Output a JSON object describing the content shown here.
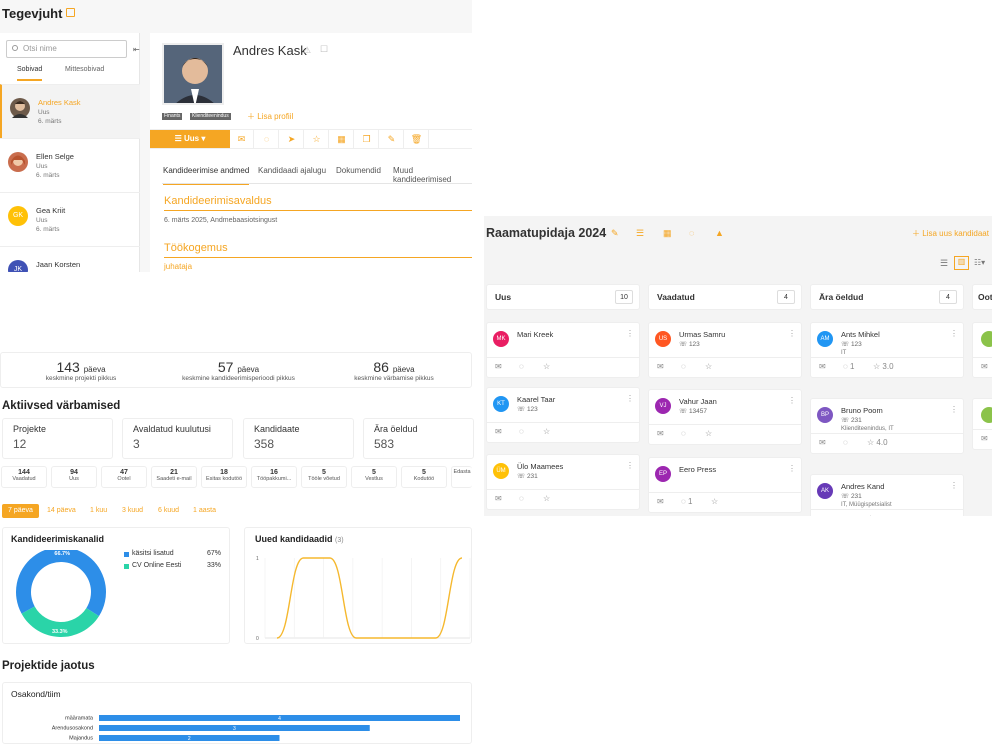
{
  "header": {
    "title": "Tegevjuht"
  },
  "sidebar": {
    "search_placeholder": "Otsi nime",
    "tabs": [
      "Sobivad",
      "Mittesobivad"
    ],
    "candidates": [
      {
        "name": "Andres Kask",
        "status": "Uus",
        "date": "6. märts"
      },
      {
        "name": "Ellen Selge",
        "status": "Uus",
        "date": "6. märts"
      },
      {
        "initials": "GK",
        "name": "Gea Kriit",
        "status": "Uus",
        "date": "6. märts"
      },
      {
        "initials": "JK",
        "name": "Jaan Korsten"
      }
    ]
  },
  "profile": {
    "name": "Andres Kask",
    "tags": [
      "Finants",
      "Klienditeenindus"
    ],
    "add_profile": "Lisa profiil",
    "new_button": "Uus",
    "tabs": [
      "Kandideerimise andmed",
      "Kandidaadi ajalugu",
      "Dokumendid",
      "Muud kandideerimised"
    ],
    "application_title": "Kandideerimisavaldus",
    "application_detail": "6. märts 2025, Andmebaasiotsingust",
    "experience_title": "Töökogemus",
    "experience_first": "juhataja"
  },
  "stats": [
    {
      "value": "143",
      "unit": "päeva",
      "label": "keskmine projekti pikkus"
    },
    {
      "value": "57",
      "unit": "päeva",
      "label": "keskmine kandideerimisperioodi pikkus"
    },
    {
      "value": "86",
      "unit": "päeva",
      "label": "keskmine värbamise pikkus"
    }
  ],
  "active": {
    "title": "Aktiivsed värbamised",
    "kpis": [
      {
        "label": "Projekte",
        "value": "12"
      },
      {
        "label": "Avaldatud kuulutusi",
        "value": "3"
      },
      {
        "label": "Kandidaate",
        "value": "358"
      },
      {
        "label": "Ära öeldud",
        "value": "583"
      }
    ],
    "minis": [
      {
        "n": "144",
        "l": "Vaadatud"
      },
      {
        "n": "94",
        "l": "Uus"
      },
      {
        "n": "47",
        "l": "Ootel"
      },
      {
        "n": "21",
        "l": "Saadeti e-mail"
      },
      {
        "n": "18",
        "l": "Esitas kodutöö"
      },
      {
        "n": "16",
        "l": "Tööpakkumi..."
      },
      {
        "n": "5",
        "l": "Tööle võetud"
      },
      {
        "n": "5",
        "l": "Vestlus"
      },
      {
        "n": "5",
        "l": "Kodutöö"
      },
      {
        "n": "",
        "l": "Edasta"
      }
    ],
    "periods": [
      "7 päeva",
      "14 päeva",
      "1 kuu",
      "3 kuud",
      "6 kuud",
      "1 aasta"
    ]
  },
  "chart_data": [
    {
      "type": "pie",
      "title": "Kandideerimiskanalid",
      "categories": [
        "käsitsi lisatud",
        "CV Online Eesti"
      ],
      "values": [
        67,
        33
      ],
      "value_labels": [
        "66.7%",
        "33.3%"
      ],
      "legend_values": [
        "67%",
        "33%"
      ],
      "colors": [
        "#2d8ee8",
        "#2ad4a8"
      ]
    },
    {
      "type": "line",
      "title": "Uued kandidaadid",
      "count": "(3)",
      "yticks": [
        "1",
        "0"
      ],
      "ylim": [
        0,
        1
      ],
      "x": [
        0,
        1,
        2,
        3,
        4,
        5,
        6,
        7
      ],
      "series": [
        {
          "values": [
            0,
            1,
            1,
            0,
            0,
            0,
            0,
            1
          ]
        }
      ]
    },
    {
      "type": "bar",
      "title": "Projektide jaotus",
      "subtitle": "Osakond/tiim",
      "categories": [
        "määramata",
        "Arendusosakond",
        "Majandus"
      ],
      "values": [
        4,
        3,
        2
      ],
      "xlim": [
        0,
        4
      ]
    }
  ],
  "board": {
    "title": "Raamatupidaja 2024",
    "add": "Lisa uus kandidaat",
    "columns": [
      {
        "name": "Uus",
        "count": "10",
        "cards": [
          {
            "initials": "MK",
            "name": "Mari Kreek",
            "phone": "",
            "color": "#e91e63"
          },
          {
            "initials": "KT",
            "name": "Kaarel Taar",
            "phone": "123",
            "color": "#2196f3"
          },
          {
            "initials": "ÜM",
            "name": "Ülo Maamees",
            "phone": "231",
            "color": "#ffc107"
          }
        ]
      },
      {
        "name": "Vaadatud",
        "count": "4",
        "cards": [
          {
            "initials": "US",
            "name": "Urmas Samru",
            "phone": "123",
            "color": "#ff5722"
          },
          {
            "initials": "VJ",
            "name": "Vahur Jaan",
            "phone": "13457",
            "color": "#9c27b0"
          },
          {
            "initials": "EP",
            "name": "Eero Press",
            "phone": "",
            "color": "#9c27b0",
            "comments": "1"
          }
        ]
      },
      {
        "name": "Ära öeldud",
        "count": "4",
        "cards": [
          {
            "initials": "AM",
            "name": "Ants Mihkel",
            "phone": "123",
            "dept": "IT",
            "color": "#2196f3",
            "comments": "1",
            "rating": "3.0"
          },
          {
            "initials": "BP",
            "name": "Bruno Poom",
            "phone": "231",
            "dept": "Klienditeenindus, IT",
            "color": "#7e57c2",
            "rating": "4.0"
          },
          {
            "initials": "AK",
            "name": "Andres Kand",
            "phone": "231",
            "dept": "IT, Müügispetsialist",
            "color": "#673ab7"
          }
        ]
      },
      {
        "name": "Oot"
      }
    ]
  }
}
